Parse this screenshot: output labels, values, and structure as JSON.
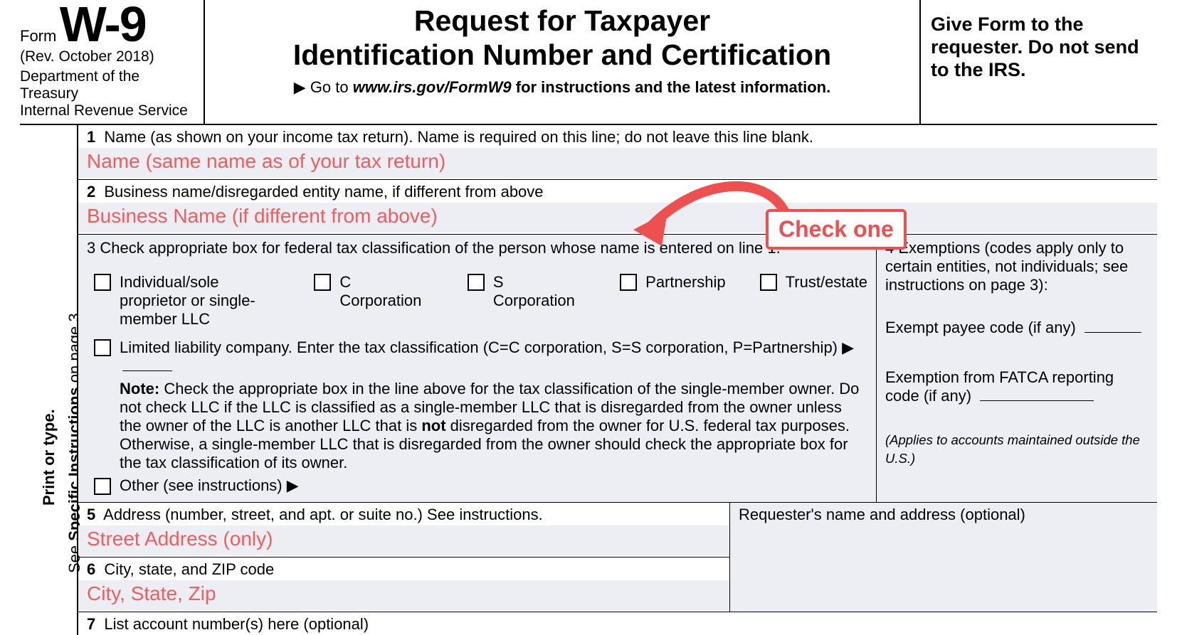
{
  "header": {
    "form_word": "Form",
    "form_id": "W-9",
    "revision": "(Rev. October 2018)",
    "dept1": "Department of the Treasury",
    "dept2": "Internal Revenue Service",
    "title_line1": "Request for Taxpayer",
    "title_line2": "Identification Number and Certification",
    "goto_prefix": "▶ Go to ",
    "goto_url": "www.irs.gov/FormW9",
    "goto_suffix": " for instructions and the latest information.",
    "give_to": "Give Form to the requester. Do not send to the IRS."
  },
  "sidebar": {
    "print_type": "Print or type.",
    "see_prefix": "See ",
    "see_bold": "Specific Instructions",
    "see_suffix": " on page 3."
  },
  "line1": {
    "num": "1",
    "label": "Name (as shown on your income tax return). Name is required on this line; do not leave this line blank.",
    "hint": "Name (same name as of your tax return)"
  },
  "line2": {
    "num": "2",
    "label": "Business name/disregarded entity name, if different from above",
    "hint": "Business Name (if different from above)"
  },
  "box3": {
    "num": "3",
    "label": "Check appropriate box for federal tax classification of the person whose name is entered on line 1.",
    "opt_individual": "Individual/sole proprietor or single-member LLC",
    "opt_ccorp": "C Corporation",
    "opt_scorp": "S Corporation",
    "opt_partnership": "Partnership",
    "opt_trust": "Trust/estate",
    "opt_llc": "Limited liability company. Enter the tax classification (C=C corporation, S=S corporation, P=Partnership) ▶",
    "note_label": "Note:",
    "note_text1": " Check the appropriate box in the line above for the tax classification of the single-member owner.  Do not check LLC if the LLC is classified as a single-member LLC that is disregarded from the owner unless the owner of the LLC is another LLC that is ",
    "note_bold": "not",
    "note_text2": " disregarded from the owner for U.S. federal tax purposes. Otherwise, a single-member LLC that is disregarded from the owner should check the appropriate box for the tax classification of its owner.",
    "opt_other": "Other (see instructions) ▶"
  },
  "box4": {
    "num": "4",
    "label": "Exemptions (codes apply only to certain entities, not individuals; see instructions on page 3):",
    "exempt_payee": "Exempt payee code (if any)",
    "fatca": "Exemption from FATCA reporting code (if any)",
    "applies": "(Applies to accounts maintained outside the U.S.)"
  },
  "line5": {
    "num": "5",
    "label": "Address (number, street, and apt. or suite no.) See instructions.",
    "hint": "Street Address (only)"
  },
  "requester": {
    "label": "Requester's name and address (optional)"
  },
  "line6": {
    "num": "6",
    "label": "City, state, and ZIP code",
    "hint": "City, State, Zip"
  },
  "line7": {
    "num": "7",
    "label": "List account number(s) here (optional)"
  },
  "annotation": {
    "callout": "Check one"
  }
}
